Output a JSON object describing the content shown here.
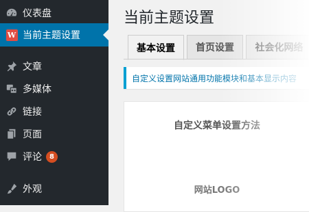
{
  "sidebar": {
    "items": [
      {
        "label": "仪表盘",
        "icon": "dashboard-icon"
      },
      {
        "label": "当前主题设置",
        "icon": "theme-logo-icon",
        "logo_text": "W",
        "current": true
      },
      {
        "label": "文章",
        "icon": "pushpin-icon"
      },
      {
        "label": "多媒体",
        "icon": "media-icon"
      },
      {
        "label": "链接",
        "icon": "link-icon"
      },
      {
        "label": "页面",
        "icon": "page-icon"
      },
      {
        "label": "评论",
        "icon": "comment-icon",
        "count": "8"
      },
      {
        "label": "外观",
        "icon": "appearance-icon"
      }
    ]
  },
  "main": {
    "title": "当前主题设置",
    "tabs": [
      {
        "label": "基本设置",
        "active": true
      },
      {
        "label": "首页设置"
      },
      {
        "label": "社会化网络"
      }
    ],
    "notice": "自定义设置网站通用功能模块和基本显示内容",
    "panel": {
      "heading": "自定义菜单设置方法",
      "subheading": "网站LOGO"
    }
  },
  "colors": {
    "sidebar_bg": "#23282d",
    "current_bg": "#0073aa",
    "badge_bg": "#d54e21",
    "logo_bg": "#e14d43"
  }
}
